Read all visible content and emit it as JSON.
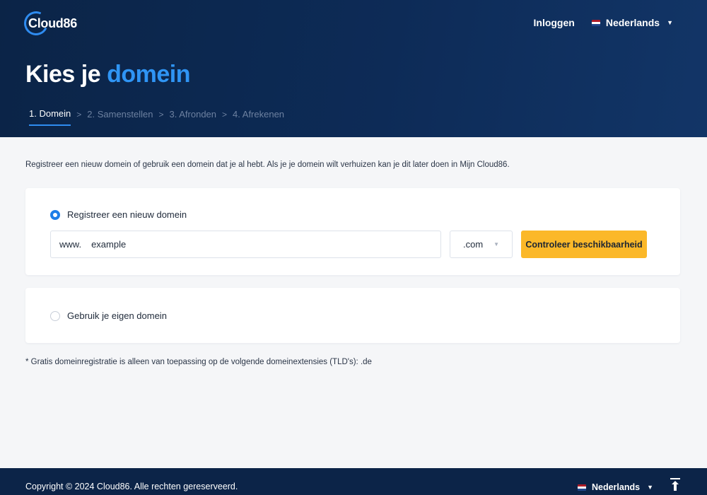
{
  "brand": {
    "logo_text": "Cloud86"
  },
  "nav": {
    "login": "Inloggen",
    "language": "Nederlands"
  },
  "page": {
    "title_main": "Kies je",
    "title_accent": "domein"
  },
  "steps": [
    {
      "label": "1. Domein",
      "active": true
    },
    {
      "label": "2. Samenstellen",
      "active": false
    },
    {
      "label": "3. Afronden",
      "active": false
    },
    {
      "label": "4. Afrekenen",
      "active": false
    }
  ],
  "step_separator": ">",
  "intro": "Registreer een nieuw domein of gebruik een domein dat je al hebt. Als je je domein wilt verhuizen kan je dit later doen in Mijn Cloud86.",
  "register": {
    "label": "Registreer een nieuw domein",
    "selected": true,
    "prefix": "www.",
    "placeholder": "example",
    "tld": ".com",
    "button": "Controleer beschikbaarheid"
  },
  "own_domain": {
    "label": "Gebruik je eigen domein",
    "selected": false
  },
  "footnote": "* Gratis domeinregistratie is alleen van toepassing op de volgende domeinextensies (TLD's): .de",
  "footer": {
    "copyright": "Copyright © 2024 Cloud86. Alle rechten gereserveerd.",
    "language": "Nederlands"
  },
  "colors": {
    "header_bg": "#0b2447",
    "accent_blue": "#2f95f5",
    "button_yellow": "#fbb829",
    "radio_blue": "#1e7ee8"
  }
}
